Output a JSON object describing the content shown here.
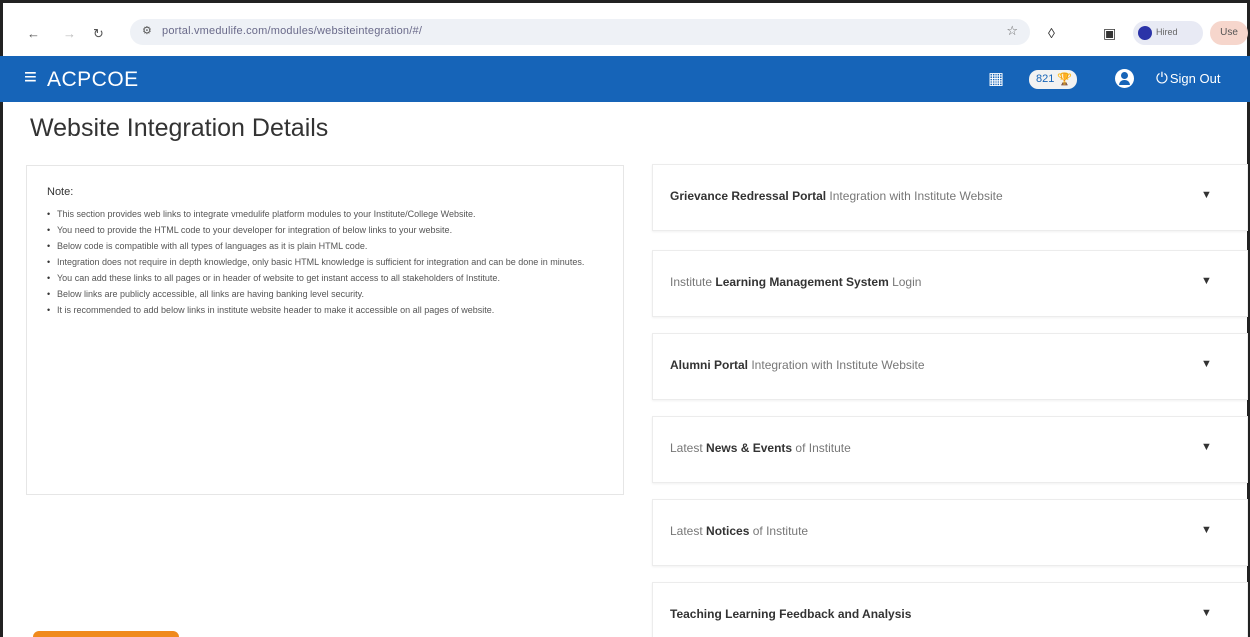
{
  "browser": {
    "back_icon": "←",
    "forward_icon": "→",
    "reload_icon": "↻",
    "url": "portal.vmedulife.com/modules/websiteintegration/#/",
    "profile_label": "Hired",
    "menu_label": "Use"
  },
  "header": {
    "brand": "ACPCOE",
    "points": "821",
    "signout_label": "Sign Out"
  },
  "page": {
    "title": "Website Integration Details"
  },
  "note": {
    "heading": "Note:",
    "items": [
      "This section provides web links to integrate vmedulife platform modules to your Institute/College Website.",
      "You need to provide the HTML code to your developer for integration of below links to your website.",
      "Below code is compatible with all types of languages as it is plain HTML code.",
      "Integration does not require in depth knowledge, only basic HTML knowledge is sufficient for integration and can be done in minutes.",
      "You can add these links to all pages or in header of website to get instant access to all stakeholders of Institute.",
      "Below links are publicly accessible, all links are having banking level security.",
      "It is recommended to add below links in institute website header to make it accessible on all pages of website."
    ]
  },
  "accordion": [
    {
      "bold": "Grievance Redressal Portal",
      "rest": " Integration with Institute Website",
      "prefix": ""
    },
    {
      "prefix": "Institute ",
      "bold": "Learning Management System",
      "rest": " Login"
    },
    {
      "bold": "Alumni Portal",
      "rest": " Integration with Institute Website",
      "prefix": ""
    },
    {
      "prefix": "Latest ",
      "bold": "News & Events",
      "rest": " of Institute"
    },
    {
      "prefix": "Latest ",
      "bold": "Notices",
      "rest": " of Institute"
    },
    {
      "prefix": "",
      "bold": "Teaching Learning Feedback and Analysis",
      "rest": ""
    }
  ],
  "icons": {
    "chevron": "chevron-down-icon",
    "menu": "hamburger-icon",
    "apps": "apps-grid-icon",
    "trophy": "trophy-icon",
    "user": "user-icon",
    "power": "power-icon"
  },
  "colors": {
    "header_bg": "#1664b8",
    "accent_orange": "#f08a1c"
  }
}
